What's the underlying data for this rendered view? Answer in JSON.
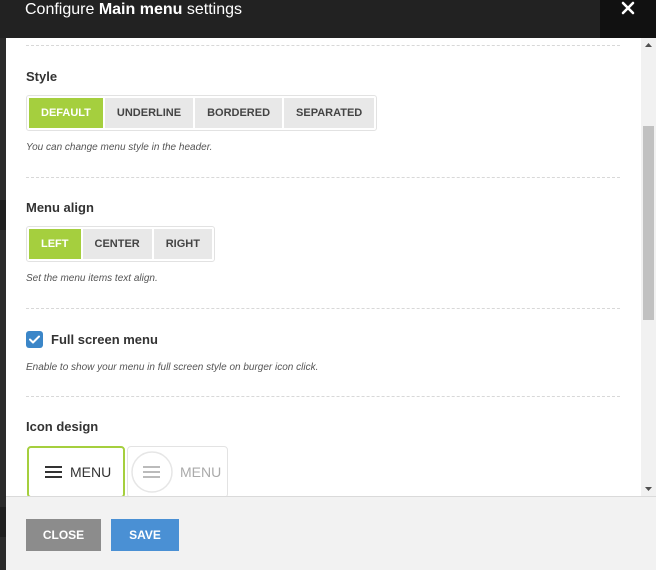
{
  "dialog": {
    "title_prefix": "Configure",
    "title_bold": "Main menu",
    "title_suffix": "settings"
  },
  "style": {
    "label": "Style",
    "options": [
      "DEFAULT",
      "UNDERLINE",
      "BORDERED",
      "SEPARATED"
    ],
    "selected": "DEFAULT",
    "hint": "You can change menu style in the header."
  },
  "menu_align": {
    "label": "Menu align",
    "options": [
      "LEFT",
      "CENTER",
      "RIGHT"
    ],
    "selected": "LEFT",
    "hint": "Set the menu items text align."
  },
  "full_screen": {
    "label": "Full screen menu",
    "checked": true,
    "hint": "Enable to show your menu in full screen style on burger icon click."
  },
  "icon_design": {
    "label": "Icon design",
    "options": [
      {
        "icon": "hamburger-icon",
        "text": "MENU",
        "selected": true
      },
      {
        "icon": "circle-hamburger-icon",
        "text": "MENU",
        "selected": false
      }
    ]
  },
  "footer": {
    "close_label": "CLOSE",
    "save_label": "SAVE"
  },
  "colors": {
    "accent": "#a5cf3e",
    "primary": "#4a90d4",
    "secondary": "#8c8c8c",
    "header_bg": "#222222"
  }
}
